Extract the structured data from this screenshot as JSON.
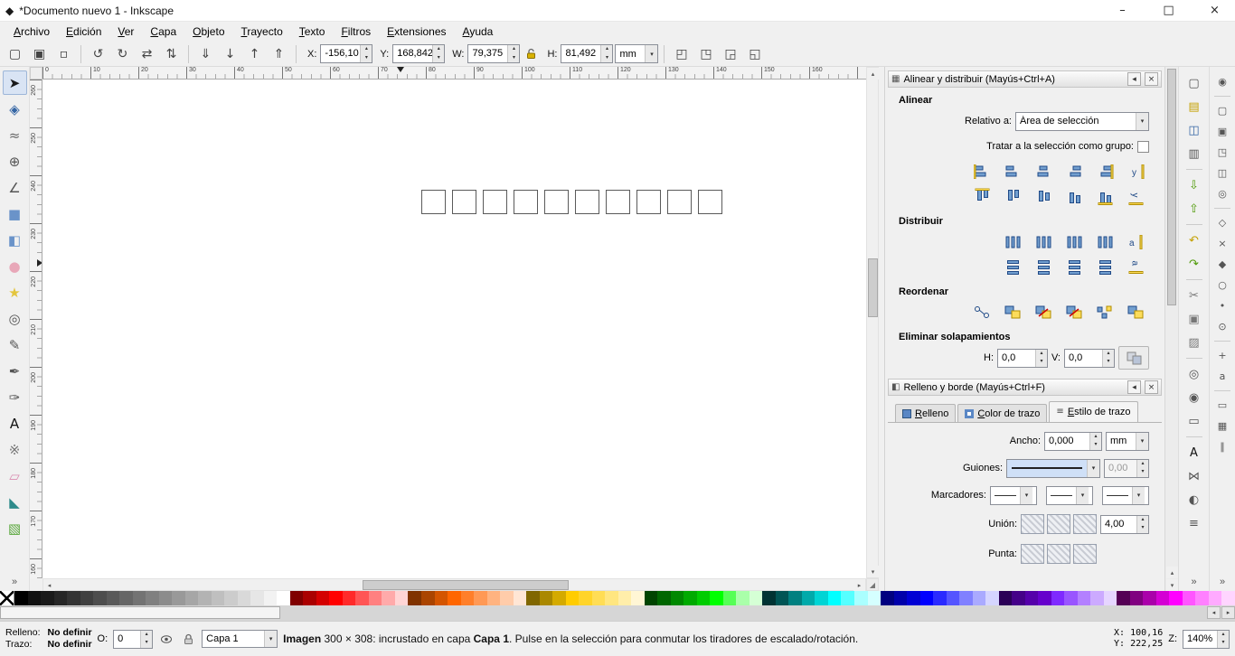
{
  "window": {
    "title": "*Documento nuevo 1 - Inkscape",
    "minimize": "–",
    "maximize": "□",
    "close": "×"
  },
  "menubar": {
    "items": [
      "Archivo",
      "Edición",
      "Ver",
      "Capa",
      "Objeto",
      "Trayecto",
      "Texto",
      "Filtros",
      "Extensiones",
      "Ayuda"
    ]
  },
  "toolbar": {
    "left_buttons": [
      {
        "name": "select-all",
        "glyph": "▢"
      },
      {
        "name": "select-all-in-all-layers",
        "glyph": "▣"
      },
      {
        "name": "deselect",
        "glyph": "▫"
      },
      "|",
      {
        "name": "rotate-90-ccw",
        "glyph": "↺"
      },
      {
        "name": "rotate-90-cw",
        "glyph": "↻"
      },
      {
        "name": "flip-horizontal",
        "glyph": "⇄"
      },
      {
        "name": "flip-vertical",
        "glyph": "⇅"
      },
      "|",
      {
        "name": "lower-to-bottom",
        "glyph": "⇓"
      },
      {
        "name": "lower-one-step",
        "glyph": "↓"
      },
      {
        "name": "raise-one-step",
        "glyph": "↑"
      },
      {
        "name": "raise-to-top",
        "glyph": "⇑"
      },
      "|"
    ],
    "fields": {
      "x_label": "X:",
      "x_value": "-156,10",
      "y_label": "Y:",
      "y_value": "168,842",
      "w_label": "W:",
      "w_value": "79,375",
      "h_label": "H:",
      "h_value": "81,492",
      "units": "mm"
    },
    "right_buttons": [
      {
        "name": "move-patterns-toggle",
        "glyph": "◰"
      },
      {
        "name": "move-gradients-toggle",
        "glyph": "◳"
      },
      {
        "name": "transform-corners-toggle",
        "glyph": "◲"
      },
      {
        "name": "transform-stroke-toggle",
        "glyph": "◱"
      }
    ]
  },
  "toolbox": {
    "tools": [
      {
        "name": "selector",
        "glyph": "➤",
        "color": "#1a1a1a",
        "active": true
      },
      {
        "name": "node-editor",
        "glyph": "◈",
        "color": "#3465a4"
      },
      {
        "name": "tweak",
        "glyph": "≈",
        "color": "#666666"
      },
      {
        "name": "zoom",
        "glyph": "⊕",
        "color": "#555555"
      },
      {
        "name": "measure",
        "glyph": "∠",
        "color": "#555555"
      },
      {
        "name": "rectangle",
        "glyph": "■",
        "color": "#6a93c9"
      },
      {
        "name": "box-3d",
        "glyph": "◧",
        "color": "#6a93c9"
      },
      {
        "name": "ellipse",
        "glyph": "●",
        "color": "#e8a7b8"
      },
      {
        "name": "star",
        "glyph": "★",
        "color": "#e3c53d"
      },
      {
        "name": "spiral",
        "glyph": "◎",
        "color": "#555555"
      },
      {
        "name": "pencil",
        "glyph": "✎",
        "color": "#555555"
      },
      {
        "name": "bezier-pen",
        "glyph": "✒",
        "color": "#555555"
      },
      {
        "name": "calligraphy",
        "glyph": "✑",
        "color": "#555555"
      },
      {
        "name": "text",
        "glyph": "A",
        "color": "#111111"
      },
      {
        "name": "spray",
        "glyph": "※",
        "color": "#777777"
      },
      {
        "name": "eraser",
        "glyph": "▱",
        "color": "#d98bb0"
      },
      {
        "name": "paint-bucket",
        "glyph": "◣",
        "color": "#2e8b8b"
      },
      {
        "name": "gradient",
        "glyph": "▧",
        "color": "#57a639"
      }
    ]
  },
  "canvas": {
    "squares_count": 10,
    "h_ruler_labels": [
      "0",
      "10",
      "20",
      "30",
      "40",
      "50",
      "60",
      "70",
      "80",
      "90",
      "100",
      "110",
      "120",
      "130",
      "140",
      "150",
      "160"
    ],
    "v_ruler_labels": [
      "260",
      "250",
      "240",
      "230",
      "220",
      "210",
      "200",
      "190",
      "180",
      "170",
      "160"
    ]
  },
  "align_panel": {
    "title": "Alinear y distribuir (Mayús+Ctrl+A)",
    "collapse_glyph": "◂",
    "close_glyph": "×",
    "align_heading": "Alinear",
    "relative_label": "Relativo a:",
    "relative_value": "Área de selección",
    "group_label": "Tratar a la selección como grupo:",
    "align_row1": [
      "align-right-edges-to-left-anchor",
      "align-left-edges",
      "center-on-vertical-axis",
      "align-right-edges",
      "align-left-edges-to-right-anchor",
      "text-anchor-horizontal"
    ],
    "align_row2": [
      "align-bottom-to-top-anchor",
      "align-top-edges",
      "center-on-horizontal-axis",
      "align-bottom-edges",
      "align-top-to-bottom-anchor",
      "text-anchor-vertical"
    ],
    "distribute_heading": "Distribuir",
    "distribute_row1": [
      "distribute-left-edges",
      "distribute-centers-horizontally",
      "distribute-right-edges",
      "equal-horizontal-gaps",
      "distribute-text-anchors-horizontally"
    ],
    "distribute_row2": [
      "distribute-top-edges",
      "distribute-centers-vertically",
      "distribute-bottom-edges",
      "equal-vertical-gaps",
      "distribute-text-anchors-vertically"
    ],
    "reorder_heading": "Reordenar",
    "reorder_row": [
      "arrange-connector-network",
      "exchange-in-selection-order",
      "exchange-in-stacking-order",
      "exchange-clockwise",
      "randomize-positions",
      "unclump"
    ],
    "overlap_heading": "Eliminar solapamientos",
    "h_label": "H:",
    "h_value": "0,0",
    "v_label": "V:",
    "v_value": "0,0"
  },
  "fill_panel": {
    "title": "Relleno y borde (Mayús+Ctrl+F)",
    "collapse_glyph": "◂",
    "close_glyph": "×",
    "tabs": [
      {
        "label": "Relleno",
        "name": "tab-fill",
        "icon": "fill"
      },
      {
        "label": "Color de trazo",
        "name": "tab-stroke-paint",
        "icon": "stroke"
      },
      {
        "label": "Estilo de trazo",
        "name": "tab-stroke-style",
        "icon": "style",
        "active": true
      }
    ],
    "width_label": "Ancho:",
    "width_value": "0,000",
    "width_units": "mm",
    "dashes_label": "Guiones:",
    "dash_offset_value": "0,00",
    "markers_label": "Marcadores:",
    "marker_slots": [
      "start-marker-dropdown",
      "mid-marker-dropdown",
      "end-marker-dropdown"
    ],
    "join_label": "Unión:",
    "join_options": [
      "miter-join",
      "round-join",
      "bevel-join"
    ],
    "miter_limit_value": "4,00",
    "cap_label": "Punta:",
    "cap_options": [
      "butt-cap",
      "round-cap",
      "square-cap"
    ]
  },
  "commands_bar": {
    "buttons": [
      {
        "name": "new-document",
        "glyph": "▢",
        "color": "#555555"
      },
      {
        "name": "open-document",
        "glyph": "▤",
        "color": "#c4a000"
      },
      {
        "name": "save-document",
        "glyph": "◫",
        "color": "#3465a4"
      },
      {
        "name": "print-document",
        "glyph": "▥",
        "color": "#555555"
      },
      "|",
      {
        "name": "import-image",
        "glyph": "⇩",
        "color": "#4e9a06"
      },
      {
        "name": "export-image",
        "glyph": "⇧",
        "color": "#4e9a06"
      },
      "|",
      {
        "name": "undo",
        "glyph": "↶",
        "color": "#c4a000"
      },
      {
        "name": "redo",
        "glyph": "↷",
        "color": "#4e9a06"
      },
      "|",
      {
        "name": "cut",
        "glyph": "✂",
        "color": "#777777"
      },
      {
        "name": "copy",
        "glyph": "▣",
        "color": "#777777"
      },
      {
        "name": "paste",
        "glyph": "▨",
        "color": "#777777"
      },
      "|",
      {
        "name": "zoom-to-selection",
        "glyph": "◎",
        "color": "#555555"
      },
      {
        "name": "zoom-to-drawing",
        "glyph": "◉",
        "color": "#555555"
      },
      {
        "name": "zoom-to-page",
        "glyph": "▭",
        "color": "#555555"
      },
      "|",
      {
        "name": "text-and-font-dialog",
        "glyph": "A",
        "color": "#111111"
      },
      {
        "name": "xml-editor",
        "glyph": "⋈",
        "color": "#555555"
      },
      {
        "name": "fill-and-stroke-dialog",
        "glyph": "◐",
        "color": "#555555"
      },
      {
        "name": "document-properties",
        "glyph": "≡",
        "color": "#555555"
      }
    ]
  },
  "snap_bar": {
    "buttons": [
      {
        "name": "enable-snapping",
        "glyph": "◉"
      },
      "|",
      {
        "name": "snap-bounding-box",
        "glyph": "▢"
      },
      {
        "name": "snap-bbox-edges",
        "glyph": "▣"
      },
      {
        "name": "snap-bbox-corners",
        "glyph": "◳"
      },
      {
        "name": "snap-bbox-edge-midpoints",
        "glyph": "◫"
      },
      {
        "name": "snap-bbox-centers",
        "glyph": "◎"
      },
      "|",
      {
        "name": "snap-nodes",
        "glyph": "◇"
      },
      {
        "name": "snap-path-intersections",
        "glyph": "×"
      },
      {
        "name": "snap-cusp-nodes",
        "glyph": "◆"
      },
      {
        "name": "snap-smooth-nodes",
        "glyph": "○"
      },
      {
        "name": "snap-midpoints",
        "glyph": "•"
      },
      {
        "name": "snap-object-centers",
        "glyph": "⊙"
      },
      "|",
      {
        "name": "snap-rotation-centers",
        "glyph": "+"
      },
      {
        "name": "snap-text-baselines",
        "glyph": "a"
      },
      "|",
      {
        "name": "snap-page-border",
        "glyph": "▭"
      },
      {
        "name": "snap-grids",
        "glyph": "▦"
      },
      {
        "name": "snap-guides",
        "glyph": "∥"
      }
    ]
  },
  "palette": {
    "colors": [
      "none",
      "#000000",
      "#111111",
      "#1a1a1a",
      "#262626",
      "#333333",
      "#404040",
      "#4d4d4d",
      "#595959",
      "#666666",
      "#737373",
      "#808080",
      "#8c8c8c",
      "#999999",
      "#a6a6a6",
      "#b3b3b3",
      "#bfbfbf",
      "#cccccc",
      "#d9d9d9",
      "#e6e6e6",
      "#f2f2f2",
      "#ffffff",
      "#800000",
      "#aa0000",
      "#d40000",
      "#ff0000",
      "#ff2a2a",
      "#ff5555",
      "#ff8080",
      "#ffaaaa",
      "#ffd5d5",
      "#803300",
      "#aa4400",
      "#d45500",
      "#ff6600",
      "#ff7f2a",
      "#ff9955",
      "#ffb380",
      "#ffccaa",
      "#ffe6d5",
      "#806600",
      "#aa8800",
      "#d4aa00",
      "#ffcc00",
      "#ffd42a",
      "#ffdd55",
      "#ffe680",
      "#ffeeaa",
      "#fff6d5",
      "#004400",
      "#006600",
      "#008800",
      "#00aa00",
      "#00cc00",
      "#00ff00",
      "#55ff55",
      "#aaffaa",
      "#d5ffd5",
      "#003333",
      "#005555",
      "#008080",
      "#00aaaa",
      "#00d4d4",
      "#00ffff",
      "#55ffff",
      "#aaffff",
      "#d5ffff",
      "#000080",
      "#0000aa",
      "#0000d4",
      "#0000ff",
      "#2a2aff",
      "#5555ff",
      "#8080ff",
      "#aaaaff",
      "#d5d5ff",
      "#2b0057",
      "#440088",
      "#5500aa",
      "#6600cc",
      "#7f2aff",
      "#9955ff",
      "#b380ff",
      "#ccaaff",
      "#e6d5ff",
      "#550055",
      "#800080",
      "#aa00aa",
      "#d400d4",
      "#ff00ff",
      "#ff55ff",
      "#ff80ff",
      "#ffaaff",
      "#ffd5ff"
    ]
  },
  "statusbar": {
    "fill_label": "Relleno:",
    "fill_value": "No definir",
    "stroke_label": "Trazo:",
    "stroke_value": "No definir",
    "opacity_label": "O:",
    "opacity_value": "0",
    "layer_name": "Capa 1",
    "message_bold1": "Imagen",
    "message_part1": " 300 × 308: incrustado en capa ",
    "message_bold2": "Capa 1",
    "message_part2": ". Pulse en la selección para conmutar los tiradores de escalado/rotación.",
    "x_label": "X:",
    "x_value": "100,16",
    "y_label": "Y:",
    "y_value": "222,25",
    "zoom_label": "Z:",
    "zoom_value": "140%"
  }
}
